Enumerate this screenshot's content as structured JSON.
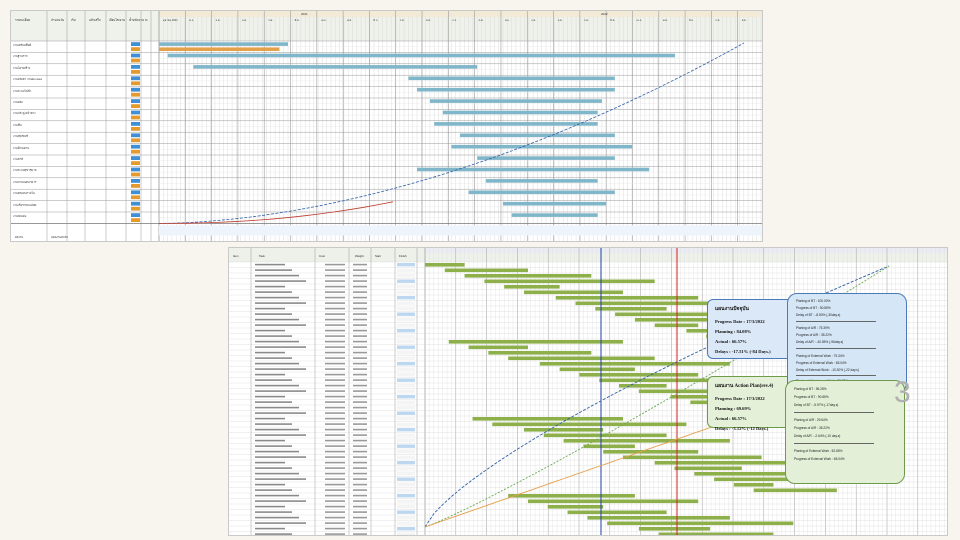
{
  "sheet1": {
    "header": {
      "task_col": "รายละเอียด",
      "cols": [
        "จำนวนวัน",
        "เริ่ม",
        "แล้วเสร็จ",
        "เงื่อนไข/งาน",
        "น้ำหนักงาน",
        "%"
      ],
      "years": [
        "2021",
        "2022"
      ],
      "months": [
        "ตุลาคม 2021",
        "พ.ย.",
        "ธ.ค.",
        "ม.ค.",
        "ก.พ.",
        "มี.ค.",
        "เม.ย.",
        "พ.ค.",
        "มิ.ย.",
        "ก.ค.",
        "ส.ค.",
        "ก.ย.",
        "ต.ค.",
        "พ.ย.",
        "ธ.ค.",
        "ม.ค.",
        "ก.พ.",
        "มี.ค.",
        "เม.ย.",
        "พ.ค.",
        "มิ.ย.",
        "ก.ค.",
        "ส.ค."
      ]
    },
    "tasks": [
      "งานเตรียมพื้นที่",
      "งานฐานราก",
      "งานโครงสร้าง",
      "งานหลังคา / Pallet area",
      "งานระบบไฟฟ้า",
      "งานผนัง",
      "งานประตู-หน้าต่าง",
      "งานพื้น",
      "งานสุขภัณฑ์",
      "งานฝ้าเพดาน",
      "งานทาสี",
      "งานระบบสุขาภิบาล",
      "งานภายนอกอาคาร",
      "งานตกแต่งภายใน",
      "งานเก็บรายละเอียด",
      "งานส่งมอบ"
    ],
    "footer": {
      "label_left": "ผลงาน",
      "label_mid": "แผนงานสะสม",
      "label_row2": "ผลงานจริง"
    }
  },
  "sheet2": {
    "header": {
      "item": "Item",
      "task": "Task",
      "cost": "Cost",
      "weight": "Weight",
      "start": "Start",
      "finish": "Finish"
    }
  },
  "callout_a": {
    "title": "แผนงานปัจจุบัน",
    "progress_date": "Progress Date : 17/3/2022",
    "planning": "Planning : 84.08%",
    "actual": "Actual : 66.57%",
    "delays": "Delays : -17.51% (-84 Days.)"
  },
  "callout_b": {
    "title": "แผนงาน Action Plan(rev.4)",
    "progress_date": "Progress Date : 17/3/2022",
    "planning": "Planning : 69.69%",
    "actual": "Actual : 66.57%",
    "delays": "Delays : -3.12% (-12 Days.)"
  },
  "stats_a": [
    "Planing of BT : 100.00%",
    "Progress of BT : 50.85%",
    "Delay of BT : -8.50% (-30day.s)",
    "Planing of A/R : 75.39%",
    "Progress of A/R : 35.22%",
    "Delay of A/R : -40.55% (-96day.s)",
    "Planing of External Work : 75.34%",
    "Progress of External Work : 65.04%",
    "Delay of External Work : -10.30% (-22 day.s)",
    "Planing of Hardscape Work : 22.28%",
    "Progress of Hardscape Work : 0.00%"
  ],
  "stats_b": [
    "Planing of BT : 96.28%",
    "Progress of BT : 90.85%",
    "Delay of BT : -5.97% (-17day.s)",
    "Planing of A/R : 29.64%",
    "Progress of A/R : 35.22%",
    "Delay of A/R : -2.64% (-10 day.s)",
    "Planing of External Work : 52.65%",
    "Progress of External Work : 65.04%"
  ],
  "page_number": "3",
  "colors": {
    "gantt_blue": "#7fb6c9",
    "gantt_green": "#8db04a",
    "gantt_orange": "#e5a04a",
    "plan_curve": "#2f5fa8",
    "actual_curve": "#c0392b",
    "today_line": "#d21f1f",
    "status_line": "#1f3fa8"
  }
}
